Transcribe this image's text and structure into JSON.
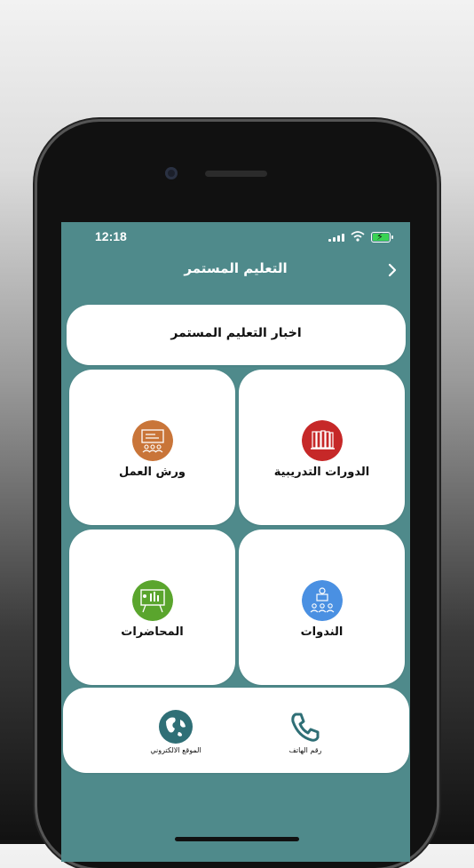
{
  "status_bar": {
    "time": "12:18"
  },
  "header": {
    "title": "التعليم المستمر"
  },
  "news_card": {
    "label": "اخبار التعليم المستمر"
  },
  "tiles": [
    {
      "label": "الدورات التدريبية",
      "icon": "books-icon",
      "color": "#c62828"
    },
    {
      "label": "ورش العمل",
      "icon": "workshop-board-icon",
      "color": "#c97539"
    },
    {
      "label": "الندوات",
      "icon": "seminar-icon",
      "color": "#4a90e2"
    },
    {
      "label": "المحاضرات",
      "icon": "lecture-board-icon",
      "color": "#5aa52d"
    }
  ],
  "contact": {
    "phone_label": "رقم الهاتف",
    "website_label": "الموقع الالكتروني",
    "website_icon_color": "#2f6f76",
    "phone_icon_color": "#2f6f76"
  }
}
